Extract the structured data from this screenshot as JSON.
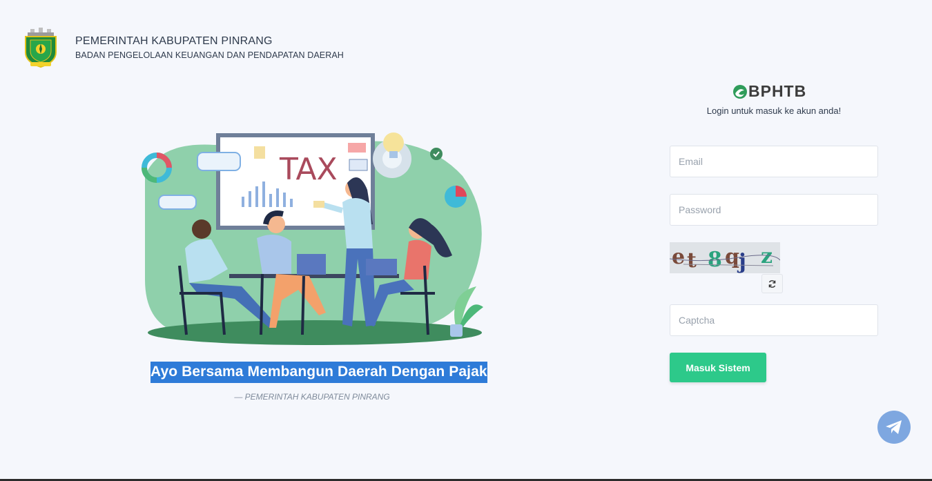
{
  "header": {
    "title": "PEMERINTAH KABUPATEN PINRANG",
    "subtitle": "BADAN PENGELOLAAN KEUANGAN DAN PENDAPATAN DAERAH",
    "logo_icon": "regency-emblem-icon"
  },
  "illustration": {
    "board_text": "TAX",
    "icon": "tax-team-illustration"
  },
  "tagline": {
    "text": "Ayo Bersama Membangun Daerah Dengan Pajak",
    "source": "— PEMERINTAH KABUPATEN PINRANG"
  },
  "login": {
    "brand": "BPHTB",
    "brand_icon": "e-leaf-icon",
    "hint": "Login untuk masuk ke akun anda!",
    "email_placeholder": "Email",
    "password_placeholder": "Password",
    "captcha_text": "et8qjz",
    "captcha_placeholder": "Captcha",
    "refresh_icon": "refresh-icon",
    "submit_label": "Masuk Sistem"
  },
  "floating": {
    "icon": "telegram-icon"
  },
  "colors": {
    "background": "#f5f7fc",
    "accent": "#2dc98a",
    "telegram": "#7ea7e0",
    "highlight": "#2e7bd8"
  }
}
